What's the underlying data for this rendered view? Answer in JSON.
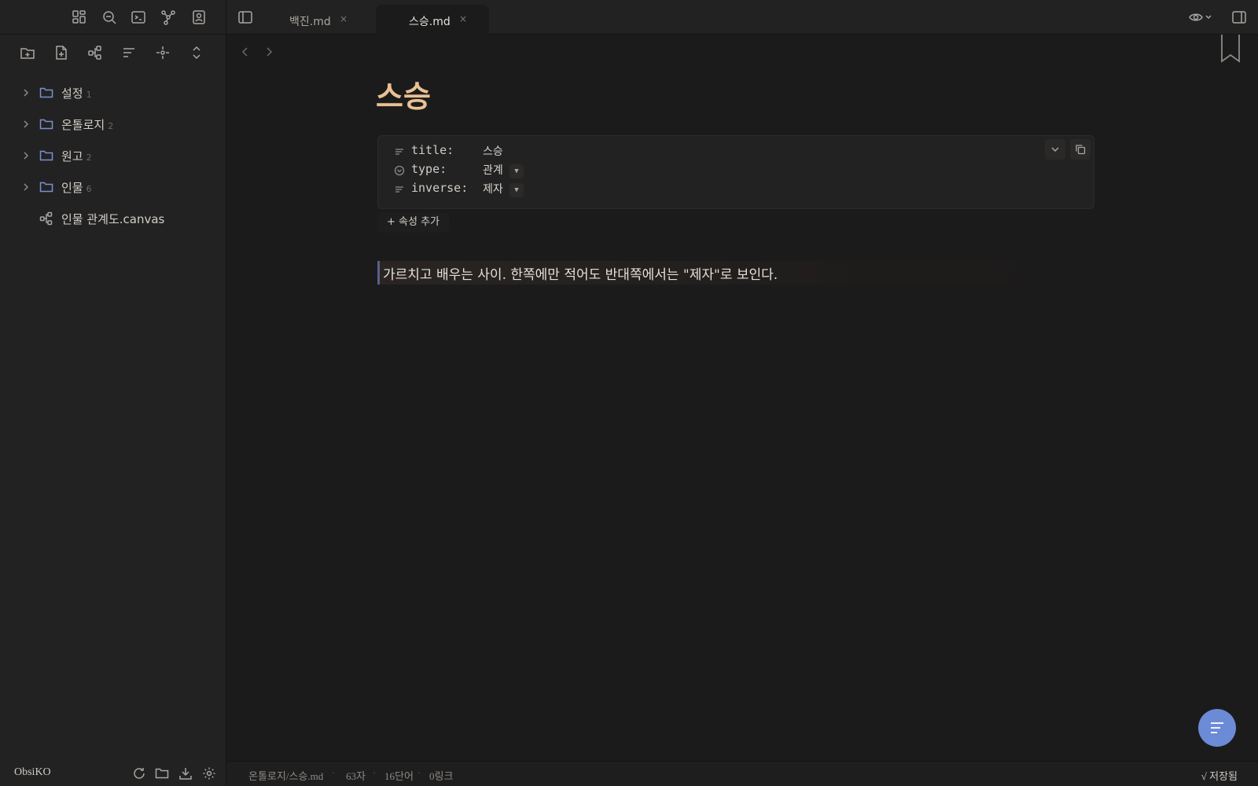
{
  "sidebar": {
    "ribbon_icons": [
      "dashboard-icon",
      "search-icon",
      "terminal-icon",
      "graph-icon",
      "contacts-icon"
    ],
    "toolbar_icons": [
      "new-folder-icon",
      "new-note-icon",
      "new-canvas-icon",
      "sort-icon",
      "locate-icon",
      "collapse-icon"
    ],
    "tree": [
      {
        "label": "설정",
        "count": "1",
        "type": "folder"
      },
      {
        "label": "온톨로지",
        "count": "2",
        "type": "folder"
      },
      {
        "label": "원고",
        "count": "2",
        "type": "folder"
      },
      {
        "label": "인물",
        "count": "6",
        "type": "folder"
      },
      {
        "label": "인물 관계도.canvas",
        "count": "",
        "type": "canvas"
      }
    ],
    "vault_name": "ObsiKO",
    "footer_icons": [
      "refresh-icon",
      "folder-icon",
      "download-icon",
      "settings-icon"
    ]
  },
  "tabs": [
    {
      "label": "백진.md",
      "close": "×",
      "active": false
    },
    {
      "label": "스승.md",
      "close": "×",
      "active": true
    }
  ],
  "note": {
    "title": "스승",
    "properties": [
      {
        "key": "title:",
        "value": "스승",
        "icon": "text-icon",
        "dropdown": false
      },
      {
        "key": "type:",
        "value": "관계",
        "icon": "select-icon",
        "dropdown": true
      },
      {
        "key": "inverse:",
        "value": "제자",
        "icon": "text-icon",
        "dropdown": true
      }
    ],
    "add_property": "+ 속성 추가",
    "body": "가르치고 배우는 사이. 한쪽에만 적어도 반대쪽에서는 \"제자\"로 보인다."
  },
  "status": {
    "path": "온톨로지/스승.md",
    "chars": "63자",
    "words": "16단어",
    "links": "0링크",
    "saved": "√ 저장됨"
  },
  "colors": {
    "accent": "#6b8bd6",
    "title": "#e8c194",
    "folder": "#7b8fd4"
  }
}
